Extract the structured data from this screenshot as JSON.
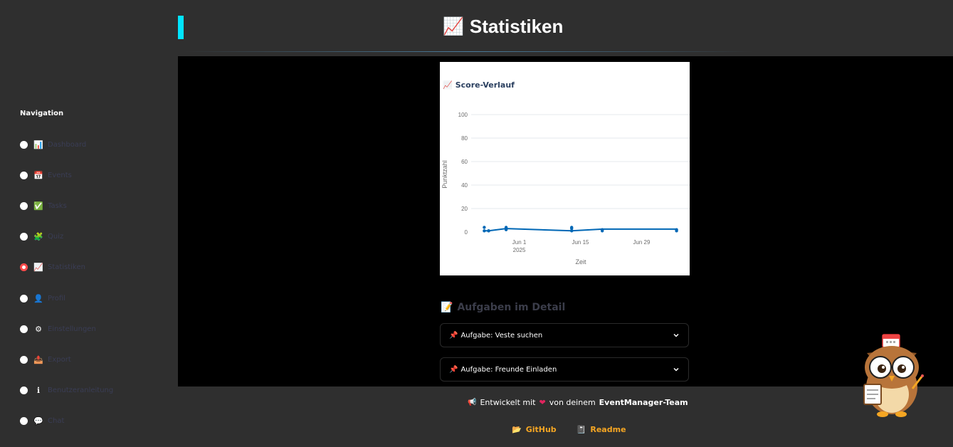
{
  "page": {
    "title": "Statistiken",
    "title_icon": "chart-increasing-icon"
  },
  "sidebar": {
    "title": "Navigation",
    "items": [
      {
        "icon": "bar-chart-icon",
        "glyph": "📊",
        "label": "Dashboard",
        "selected": false
      },
      {
        "icon": "calendar-icon",
        "glyph": "📅",
        "label": "Events",
        "selected": false
      },
      {
        "icon": "check-icon",
        "glyph": "✅",
        "label": "Tasks",
        "selected": false
      },
      {
        "icon": "puzzle-icon",
        "glyph": "🧩",
        "label": "Quiz",
        "selected": false
      },
      {
        "icon": "chart-increasing-icon",
        "glyph": "📈",
        "label": "Statistiken",
        "selected": true
      },
      {
        "icon": "profile-icon",
        "glyph": "👤",
        "label": "Profil",
        "selected": false
      },
      {
        "icon": "gear-icon",
        "glyph": "⚙",
        "label": "Einstellungen",
        "selected": false
      },
      {
        "icon": "upload-icon",
        "glyph": "📤",
        "label": "Export",
        "selected": false
      },
      {
        "icon": "info-icon",
        "glyph": "ℹ",
        "label": "Benutzeranleitung",
        "selected": false
      },
      {
        "icon": "speech-bubble-icon",
        "glyph": "💬",
        "label": "Chat",
        "selected": false
      }
    ]
  },
  "chart_section": {
    "title": "Score-Verlauf",
    "icon": "chart-increasing-icon"
  },
  "chart_data": {
    "type": "line",
    "title": "Score-Verlauf",
    "xlabel": "Zeit",
    "ylabel": "Punktzahl",
    "ylim": [
      0,
      100
    ],
    "yticks": [
      0,
      20,
      40,
      60,
      80,
      100
    ],
    "xticks": [
      {
        "date": "2025-06-01",
        "label": "Jun 1",
        "sublabel": "2025"
      },
      {
        "date": "2025-06-15",
        "label": "Jun 15",
        "sublabel": ""
      },
      {
        "date": "2025-06-29",
        "label": "Jun 29",
        "sublabel": ""
      }
    ],
    "xlim": [
      "2025-05-21",
      "2025-07-10"
    ],
    "grid": true,
    "color": "#0067b5",
    "series": [
      {
        "points": [
          {
            "x": "2025-05-24",
            "y": 4
          },
          {
            "x": "2025-05-24",
            "y": 1
          },
          {
            "x": "2025-05-25",
            "y": 1
          },
          {
            "x": "2025-05-25",
            "y": 1
          },
          {
            "x": "2025-05-29",
            "y": 4
          },
          {
            "x": "2025-05-29",
            "y": 3
          },
          {
            "x": "2025-05-29",
            "y": 2
          },
          {
            "x": "2025-06-13",
            "y": 4
          },
          {
            "x": "2025-06-13",
            "y": 3
          },
          {
            "x": "2025-06-13",
            "y": 1
          },
          {
            "x": "2025-06-20",
            "y": 2
          },
          {
            "x": "2025-06-20",
            "y": 1
          },
          {
            "x": "2025-07-07",
            "y": 2
          },
          {
            "x": "2025-07-07",
            "y": 1
          }
        ],
        "line": [
          {
            "x": "2025-05-24",
            "y": 1
          },
          {
            "x": "2025-05-25",
            "y": 1
          },
          {
            "x": "2025-05-29",
            "y": 3
          },
          {
            "x": "2025-06-13",
            "y": 1
          },
          {
            "x": "2025-06-20",
            "y": 2.5
          },
          {
            "x": "2025-07-07",
            "y": 2.5
          }
        ]
      }
    ]
  },
  "details": {
    "title": "Aufgaben im Detail",
    "icon": "memo-icon",
    "items": [
      {
        "label": "Aufgabe: Veste suchen",
        "icon": "pushpin-icon"
      },
      {
        "label": "Aufgabe: Freunde Einladen",
        "icon": "pushpin-icon"
      }
    ]
  },
  "footer": {
    "pre": "Entwickelt mit",
    "mid": "von deinem",
    "team": "EventManager-Team",
    "links": [
      {
        "label": "GitHub",
        "icon": "folder-icon"
      },
      {
        "label": "Readme",
        "icon": "book-icon"
      }
    ]
  },
  "colors": {
    "accent": "#00e5ff",
    "link": "#f5a623",
    "selected_radio": "#ff4b4b",
    "line": "#0067b5"
  }
}
